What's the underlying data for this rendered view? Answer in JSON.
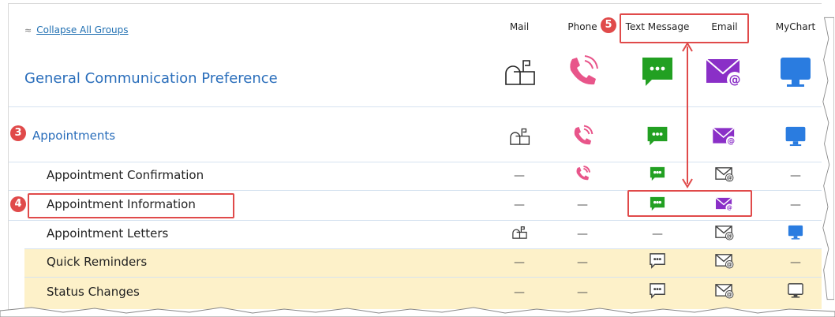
{
  "toolbar": {
    "collapse_label": "Collapse All Groups"
  },
  "columns": [
    {
      "key": "mail",
      "label": "Mail"
    },
    {
      "key": "phone",
      "label": "Phone"
    },
    {
      "key": "text",
      "label": "Text Message"
    },
    {
      "key": "email",
      "label": "Email"
    },
    {
      "key": "mychart",
      "label": "MyChart"
    }
  ],
  "general": {
    "title": "General Communication Preference"
  },
  "group": {
    "title": "Appointments"
  },
  "rows": [
    {
      "label": "Appointment Confirmation",
      "mail": "—",
      "phone": "phone",
      "text": "text",
      "email": "email-outline",
      "mychart": "—"
    },
    {
      "label": "Appointment Information",
      "mail": "—",
      "phone": "—",
      "text": "text",
      "email": "email",
      "mychart": "—"
    },
    {
      "label": "Appointment Letters",
      "mail": "mailbox",
      "phone": "—",
      "text": "—",
      "email": "email-outline",
      "mychart": "monitor"
    },
    {
      "label": "Quick Reminders",
      "mail": "—",
      "phone": "—",
      "text": "text-outline",
      "email": "email-outline",
      "mychart": "—"
    },
    {
      "label": "Status Changes",
      "mail": "—",
      "phone": "—",
      "text": "text-outline",
      "email": "email-outline",
      "mychart": "monitor-outline"
    }
  ],
  "callouts": {
    "three": "3",
    "four": "4",
    "five": "5"
  },
  "colors": {
    "link": "#1f6fb2",
    "title": "#2a6ebb",
    "phone": "#e8558a",
    "text": "#22a022",
    "email": "#8a2fc7",
    "mychart": "#2a7ce0",
    "highlight": "#fdf1c9",
    "callout": "#e04a4a"
  }
}
